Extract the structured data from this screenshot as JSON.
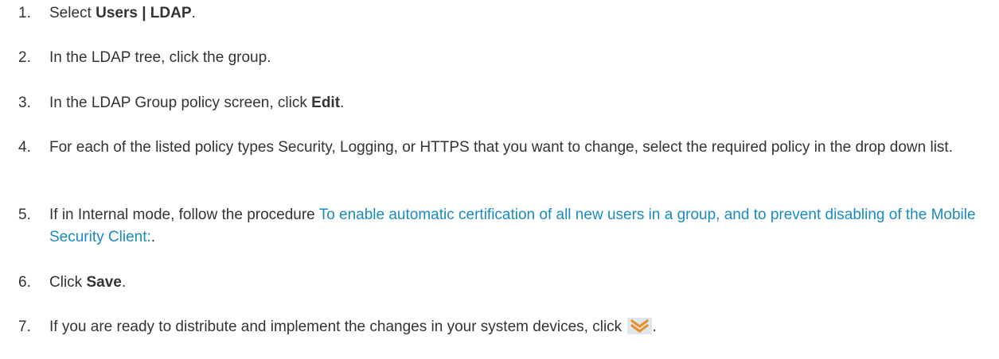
{
  "steps": [
    {
      "num": "1.",
      "pre": "Select ",
      "bold": "Users | LDAP",
      "post": "."
    },
    {
      "num": "2.",
      "text": "In the LDAP tree, click the group."
    },
    {
      "num": "3.",
      "pre": "In the LDAP Group policy screen, click ",
      "bold": "Edit",
      "post": "."
    },
    {
      "num": "4.",
      "text": "For each of the listed policy types Security, Logging, or HTTPS that you want to change, select the required policy in the drop down list."
    },
    {
      "num": "5.",
      "pre": "If in Internal mode, follow the procedure ",
      "link": "To enable automatic certification of all new users in a group, and to prevent disabling of the Mobile Security Client:",
      "post": "."
    },
    {
      "num": "6.",
      "pre": "Click ",
      "bold": "Save",
      "post": "."
    },
    {
      "num": "7.",
      "pre": "If you are ready to distribute and implement the changes in your system devices, click ",
      "icon": "deploy-chevron-down-icon",
      "post": "."
    }
  ],
  "colors": {
    "text": "#333333",
    "link": "#1a8bbf",
    "icon_orange": "#e8902a",
    "icon_bg": "#dde7ec"
  }
}
